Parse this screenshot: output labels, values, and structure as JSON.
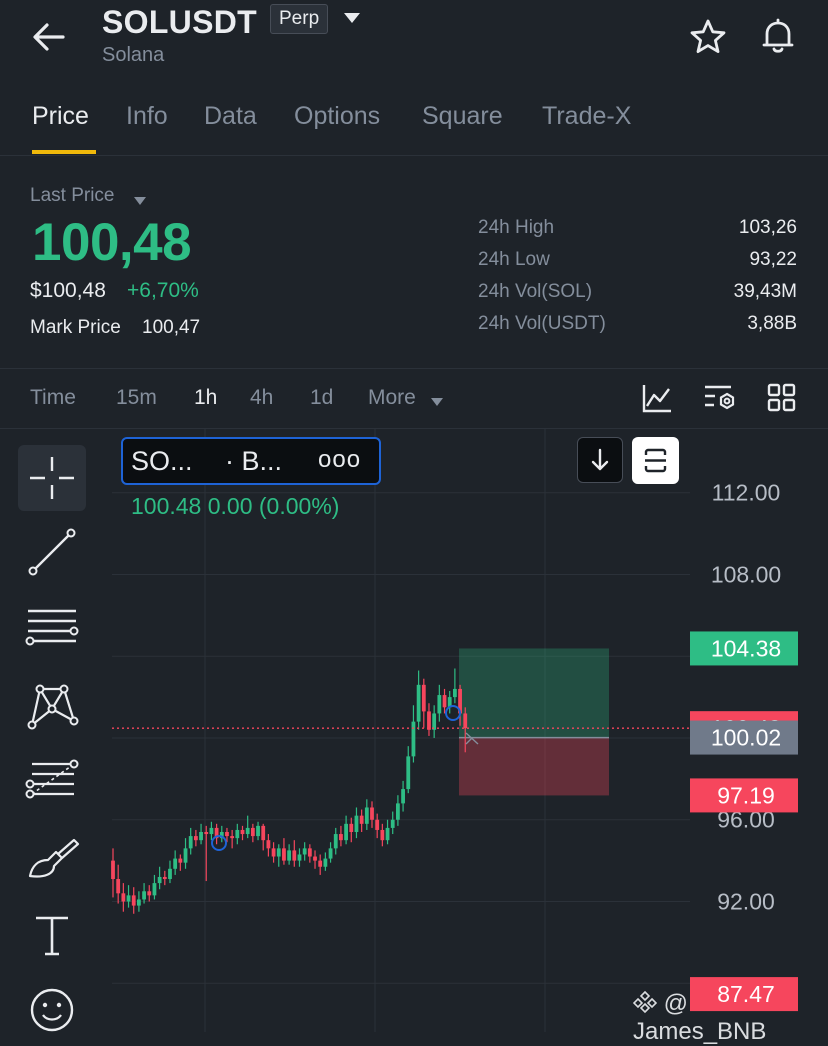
{
  "header": {
    "symbol": "SOLUSDT",
    "contract_badge": "Perp",
    "name": "Solana"
  },
  "tabs": [
    "Price",
    "Info",
    "Data",
    "Options",
    "Square",
    "Trade-X"
  ],
  "active_tab": "Price",
  "price": {
    "last_price_label": "Last Price",
    "last_price": "100,48",
    "usd_price": "$100,48",
    "change_pct": "+6,70%",
    "mark_price_label": "Mark Price",
    "mark_price": "100,47"
  },
  "stats": [
    {
      "label": "24h High",
      "value": "103,26"
    },
    {
      "label": "24h Low",
      "value": "93,22"
    },
    {
      "label": "24h Vol(SOL)",
      "value": "39,43M"
    },
    {
      "label": "24h Vol(USDT)",
      "value": "3,88B"
    }
  ],
  "intervals": [
    "Time",
    "15m",
    "1h",
    "4h",
    "1d",
    "More"
  ],
  "active_interval": "1h",
  "chart_legend": {
    "symbol": "SO...",
    "source": "· B...",
    "menu": "ooo",
    "values": "100.48  0.00 (0.00%)"
  },
  "watermark": "@ James_BNB",
  "colors": {
    "up": "#2ebd85",
    "down": "#f6465d",
    "accent": "#f0b90b",
    "background": "#1e2329"
  },
  "icons": {
    "back": "arrow-left-icon",
    "dropdown": "caret-down-icon",
    "favorite": "star-icon",
    "alert": "bell-icon",
    "indicators": "chart-indicator-icon",
    "settings": "chart-settings-icon",
    "layout": "grid-icon",
    "scroll_latest": "arrow-down-icon",
    "fit": "fit-screen-icon"
  },
  "drawing_tools": [
    "crosshair-icon",
    "trend-line-icon",
    "horizontal-lines-icon",
    "pattern-icon",
    "fib-icon",
    "brush-icon",
    "text-icon",
    "emoji-icon"
  ],
  "chart_data": {
    "type": "candlestick",
    "y_ticks": [
      "112.00",
      "108.00",
      "96.00",
      "92.00"
    ],
    "ylim": [
      86.5,
      113.5
    ],
    "last_price_label": "100.48",
    "price_tags": [
      {
        "value": "104.38",
        "color": "#2ebd85"
      },
      {
        "value": "100.48",
        "color": "#f6465d"
      },
      {
        "value": "100.02",
        "color": "#707a8a"
      },
      {
        "value": "97.19",
        "color": "#f6465d"
      },
      {
        "value": "87.47",
        "color": "#f6465d"
      }
    ],
    "position_tool": {
      "entry": 100.02,
      "take_profit": 104.38,
      "stop_loss": 97.19
    },
    "candles": [
      [
        94.0,
        93.1,
        94.6,
        92.2
      ],
      [
        93.1,
        92.4,
        93.8,
        91.9
      ],
      [
        92.4,
        92.0,
        92.9,
        91.5
      ],
      [
        92.0,
        92.3,
        92.8,
        91.7
      ],
      [
        92.3,
        91.8,
        92.7,
        91.4
      ],
      [
        91.8,
        92.1,
        92.5,
        91.5
      ],
      [
        92.1,
        92.5,
        92.9,
        91.9
      ],
      [
        92.5,
        92.3,
        92.8,
        92.0
      ],
      [
        92.3,
        92.9,
        93.3,
        92.1
      ],
      [
        92.9,
        93.2,
        93.7,
        92.6
      ],
      [
        93.2,
        93.1,
        93.5,
        92.8
      ],
      [
        93.1,
        93.6,
        94.0,
        92.9
      ],
      [
        93.6,
        94.1,
        94.5,
        93.3
      ],
      [
        94.1,
        93.9,
        94.3,
        93.5
      ],
      [
        93.9,
        94.6,
        95.1,
        93.6
      ],
      [
        94.6,
        95.2,
        95.6,
        94.3
      ],
      [
        95.2,
        95.0,
        95.5,
        94.7
      ],
      [
        95.0,
        95.4,
        95.8,
        94.8
      ],
      [
        95.4,
        95.3,
        95.7,
        93.0
      ],
      [
        95.3,
        95.6,
        95.9,
        95.0
      ],
      [
        95.6,
        95.1,
        95.8,
        94.8
      ],
      [
        95.1,
        95.4,
        95.7,
        94.9
      ],
      [
        95.4,
        95.2,
        95.6,
        94.9
      ],
      [
        95.2,
        95.1,
        95.5,
        94.6
      ],
      [
        95.1,
        95.5,
        95.8,
        94.8
      ],
      [
        95.5,
        95.3,
        95.7,
        95.0
      ],
      [
        95.3,
        95.6,
        96.2,
        95.1
      ],
      [
        95.6,
        95.2,
        95.8,
        94.9
      ],
      [
        95.2,
        95.7,
        95.9,
        95.0
      ],
      [
        95.7,
        95.0,
        95.8,
        94.5
      ],
      [
        95.0,
        94.6,
        95.3,
        94.2
      ],
      [
        94.6,
        94.2,
        94.9,
        93.9
      ],
      [
        94.2,
        94.6,
        94.8,
        93.7
      ],
      [
        94.6,
        94.0,
        95.1,
        93.8
      ],
      [
        94.0,
        94.5,
        94.8,
        93.8
      ],
      [
        94.5,
        94.0,
        95.0,
        93.7
      ],
      [
        94.0,
        94.3,
        94.6,
        93.7
      ],
      [
        94.3,
        94.6,
        94.9,
        94.0
      ],
      [
        94.6,
        94.2,
        94.8,
        93.9
      ],
      [
        94.2,
        94.0,
        94.5,
        93.6
      ],
      [
        94.0,
        93.7,
        94.3,
        93.3
      ],
      [
        93.7,
        94.1,
        94.4,
        93.5
      ],
      [
        94.1,
        94.6,
        94.9,
        93.9
      ],
      [
        94.6,
        95.3,
        95.6,
        94.3
      ],
      [
        95.3,
        95.0,
        95.7,
        94.7
      ],
      [
        95.0,
        95.8,
        96.2,
        94.8
      ],
      [
        95.8,
        95.4,
        96.1,
        94.9
      ],
      [
        95.4,
        96.2,
        96.6,
        95.1
      ],
      [
        96.2,
        95.8,
        96.5,
        95.4
      ],
      [
        95.8,
        96.6,
        97.0,
        95.5
      ],
      [
        96.6,
        96.0,
        96.9,
        95.6
      ],
      [
        96.0,
        95.5,
        96.3,
        95.1
      ],
      [
        95.5,
        95.0,
        95.8,
        94.7
      ],
      [
        95.0,
        95.6,
        96.0,
        94.8
      ],
      [
        95.6,
        96.0,
        96.4,
        95.3
      ],
      [
        96.0,
        96.8,
        97.2,
        95.7
      ],
      [
        96.8,
        97.5,
        97.9,
        96.4
      ],
      [
        97.5,
        99.1,
        99.6,
        97.3
      ],
      [
        99.1,
        100.8,
        101.6,
        98.8
      ],
      [
        100.8,
        102.6,
        103.3,
        100.4
      ],
      [
        102.6,
        101.3,
        102.9,
        100.5
      ],
      [
        101.3,
        100.4,
        101.7,
        100.1
      ],
      [
        100.4,
        101.2,
        101.6,
        100.0
      ],
      [
        101.2,
        102.1,
        102.6,
        100.8
      ],
      [
        102.1,
        101.5,
        102.4,
        101.2
      ],
      [
        101.5,
        102.0,
        102.3,
        101.2
      ],
      [
        102.0,
        102.4,
        103.4,
        101.7
      ],
      [
        102.4,
        101.2,
        102.6,
        100.6
      ],
      [
        101.2,
        100.48,
        101.5,
        99.3
      ]
    ]
  }
}
